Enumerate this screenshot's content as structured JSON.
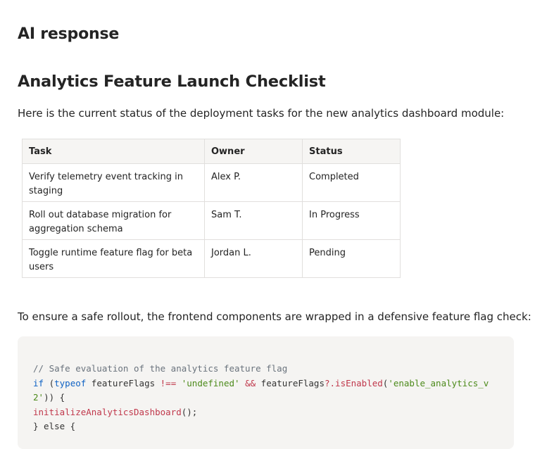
{
  "heading": "AI response",
  "title": "Analytics Feature Launch Checklist",
  "intro": "Here is the current status of the deployment tasks for the new analytics dashboard module:",
  "table": {
    "headers": [
      "Task",
      "Owner",
      "Status"
    ],
    "rows": [
      [
        "Verify telemetry event tracking in staging",
        "Alex P.",
        "Completed"
      ],
      [
        "Roll out database migration for aggregation schema",
        "Sam T.",
        "In Progress"
      ],
      [
        "Toggle runtime feature flag for beta users",
        "Jordan L.",
        "Pending"
      ]
    ]
  },
  "outro": "To ensure a safe rollout, the frontend components are wrapped in a defensive feature flag check:",
  "code": {
    "comment": "// Safe evaluation of the analytics feature flag",
    "if_kw": "if",
    "paren_open": " (",
    "typeof_kw": "typeof",
    "var1": " featureFlags ",
    "neq": "!==",
    "space1": " ",
    "undef_str": "'undefined'",
    "space2": " ",
    "and_op": "&&",
    "var2": " featureFlags",
    "optional": "?.",
    "method": "isEnabled",
    "paren2": "(",
    "flag_str_a": "'enable_analytics_v",
    "flag_str_b": "2'",
    "close": ")) {",
    "call": "initializeAnalyticsDashboard",
    "call_end": "();",
    "else_line": "} else {"
  }
}
